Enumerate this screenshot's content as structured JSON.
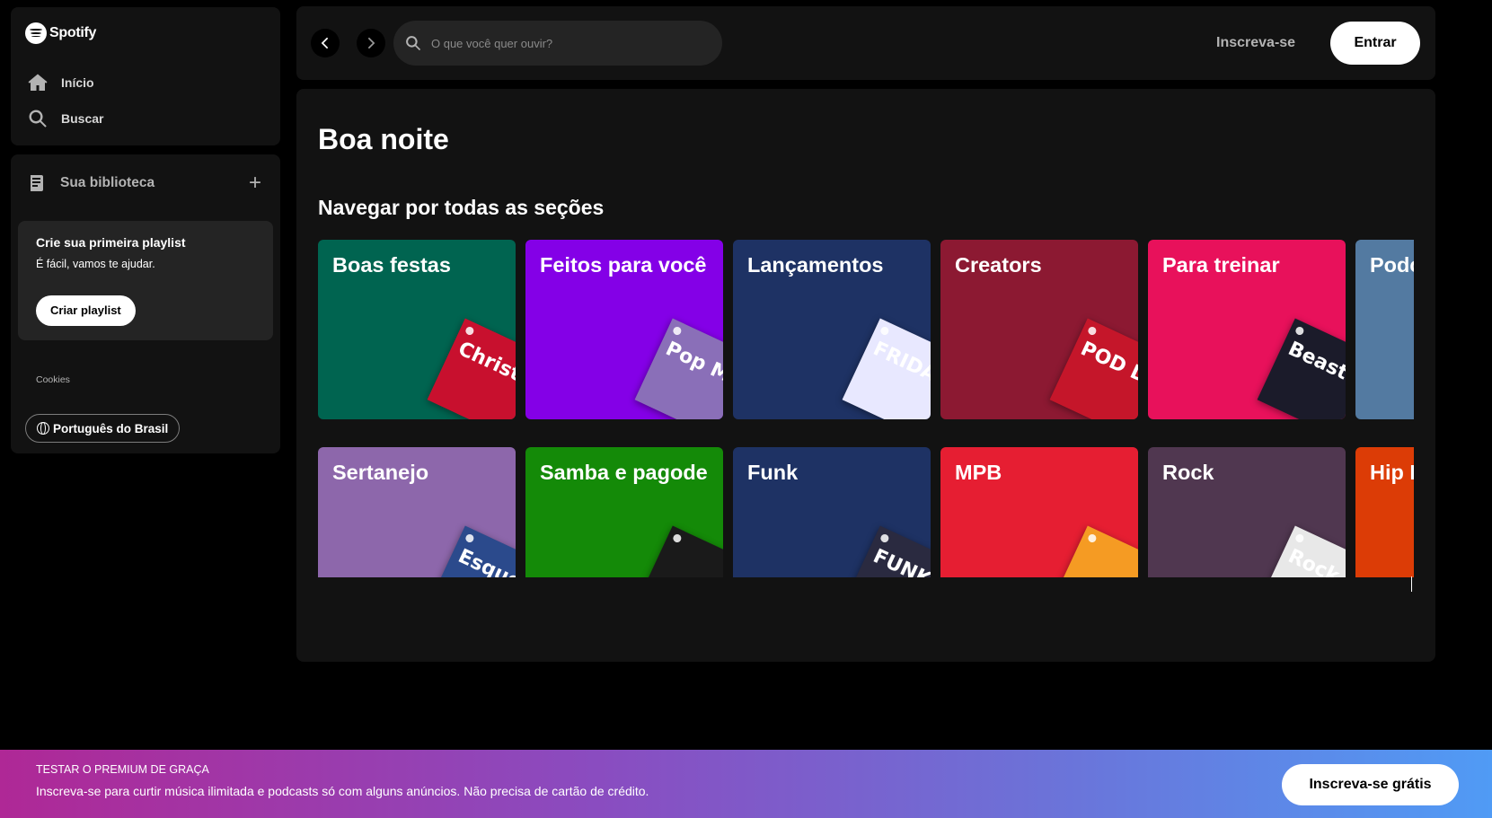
{
  "app": {
    "name": "Spotify"
  },
  "sidebar": {
    "nav": [
      {
        "label": "Início",
        "icon": "home-icon"
      },
      {
        "label": "Buscar",
        "icon": "search-icon"
      }
    ],
    "library": {
      "title": "Sua biblioteca",
      "add_icon": "plus-icon",
      "create_card": {
        "title": "Crie sua primeira playlist",
        "subtitle": "É fácil, vamos te ajudar.",
        "button": "Criar playlist"
      },
      "cookies": "Cookies",
      "language": "Português do Brasil"
    }
  },
  "topbar": {
    "search_placeholder": "O que você quer ouvir?",
    "signup": "Inscreva-se",
    "login": "Entrar"
  },
  "main": {
    "greeting": "Boa noite",
    "section_title": "Navegar por todas as seções",
    "tiles": [
      {
        "label": "Boas festas",
        "color": "#006450",
        "art_color": "#c8102e",
        "art_text": "Christmas Hits"
      },
      {
        "label": "Feitos para você",
        "color": "#8400e7",
        "art_color": "#8a6fb8",
        "art_text": "Pop Mix"
      },
      {
        "label": "Lançamentos",
        "color": "#1e3264",
        "art_color": "#e8e8ff",
        "art_text": "FRIDAY"
      },
      {
        "label": "Creators",
        "color": "#8c1932",
        "art_color": "#c5162a",
        "art_text": "POD DELAS"
      },
      {
        "label": "Para treinar",
        "color": "#e8115b",
        "art_color": "#1b1b2a",
        "art_text": "Beast Mode"
      },
      {
        "label": "Podcasts",
        "color": "#537aa1",
        "art_color": "#537aa1",
        "art_text": ""
      },
      {
        "label": "Sertanejo",
        "color": "#8d67ab",
        "art_color": "#2b4a8c",
        "art_text": "Esquenta Sertanejo"
      },
      {
        "label": "Samba e pagode",
        "color": "#148a08",
        "art_color": "#1a1a1a",
        "art_text": ""
      },
      {
        "label": "Funk",
        "color": "#1e3264",
        "art_color": "#2a2a40",
        "art_text": "FUNK"
      },
      {
        "label": "MPB",
        "color": "#e61e32",
        "art_color": "#f59b23",
        "art_text": ""
      },
      {
        "label": "Rock",
        "color": "#503750",
        "art_color": "#e8e8e8",
        "art_text": "Rock This"
      },
      {
        "label": "Hip Hop",
        "color": "#dc3c06",
        "art_color": "#dc3c06",
        "art_text": ""
      }
    ]
  },
  "banner": {
    "kicker": "TESTAR O PREMIUM DE GRAÇA",
    "text": "Inscreva-se para curtir música ilimitada e podcasts só com alguns anúncios. Não precisa de cartão de crédito.",
    "button": "Inscreva-se grátis"
  }
}
